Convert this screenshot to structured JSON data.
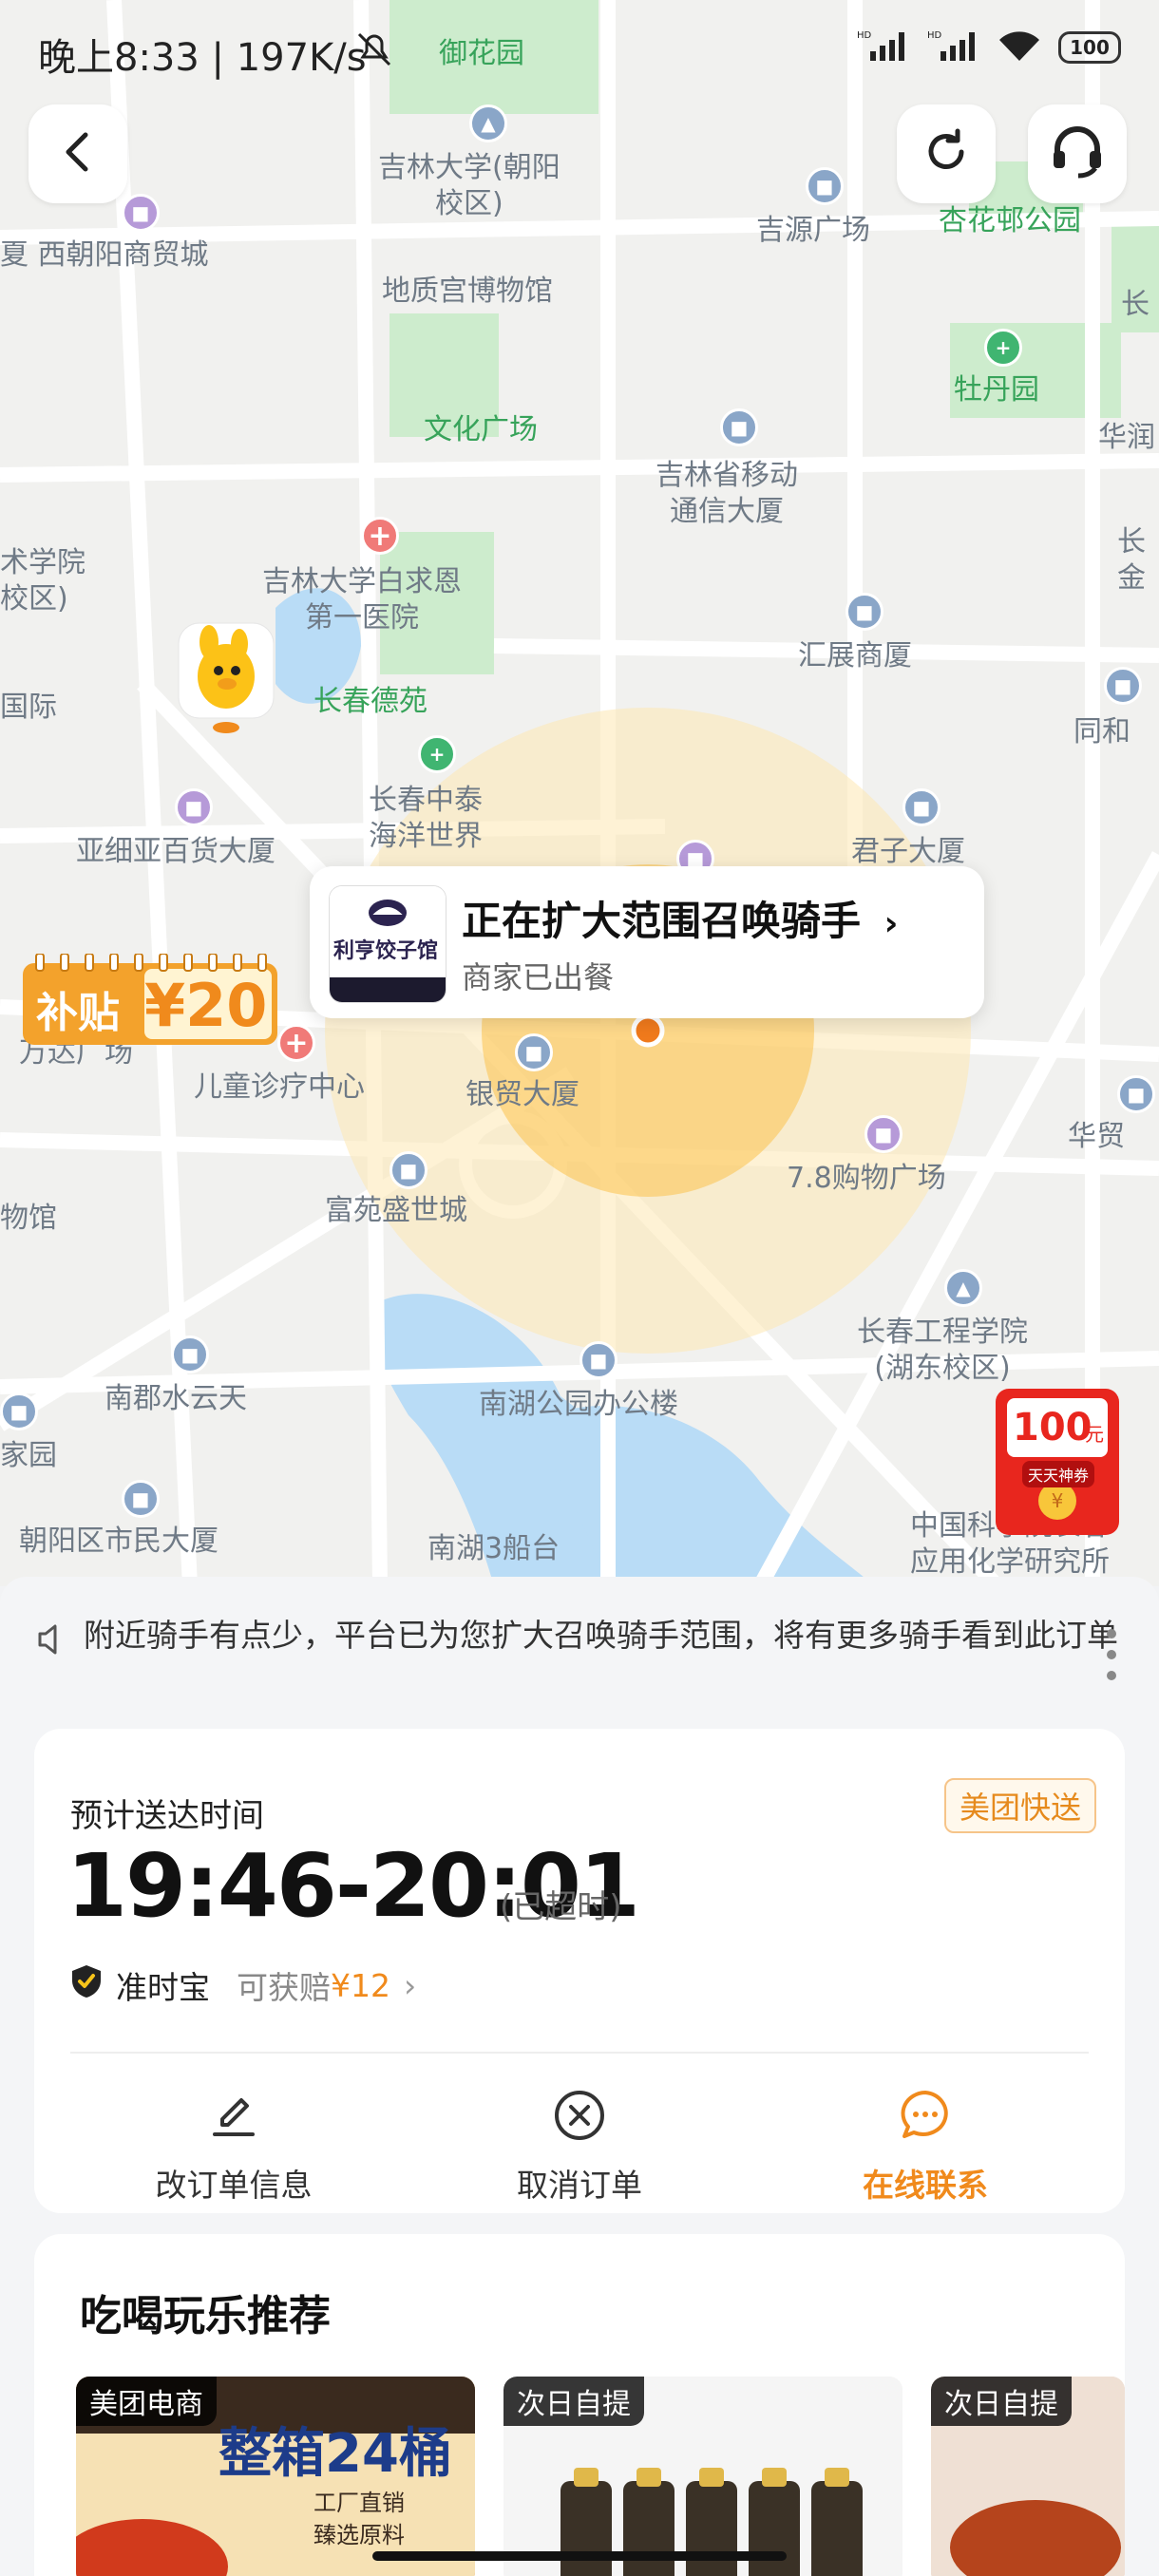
{
  "status_bar": {
    "time": "晚上8:33 | 197K/s",
    "battery": "100"
  },
  "map": {
    "labels": [
      {
        "text": "御花园",
        "color": "green"
      },
      {
        "text": "吉林大学(朝阳\n校区)",
        "color": "gray"
      },
      {
        "text": "吉源广场",
        "color": "gray"
      },
      {
        "text": "杏花邨公园",
        "color": "green"
      },
      {
        "text": "夏 西朝阳商贸城",
        "color": "gray"
      },
      {
        "text": "地质宫博物馆",
        "color": "gray"
      },
      {
        "text": "牡丹园",
        "color": "green"
      },
      {
        "text": "长",
        "color": "gray"
      },
      {
        "text": "华润",
        "color": "gray"
      },
      {
        "text": "文化广场",
        "color": "green"
      },
      {
        "text": "吉林省移动\n通信大厦",
        "color": "gray"
      },
      {
        "text": "术学院\n校区)",
        "color": "gray"
      },
      {
        "text": "吉林大学白求恩\n第一医院",
        "color": "gray"
      },
      {
        "text": "长\n金",
        "color": "gray"
      },
      {
        "text": "汇展商厦",
        "color": "gray"
      },
      {
        "text": "国际",
        "color": "gray"
      },
      {
        "text": "长春德苑",
        "color": "green"
      },
      {
        "text": "同和",
        "color": "gray"
      },
      {
        "text": "长春中泰\n海洋世界",
        "color": "gray"
      },
      {
        "text": "亚细亚百货大厦",
        "color": "gray"
      },
      {
        "text": "君子大厦",
        "color": "gray"
      },
      {
        "text": "万达广场",
        "color": "gray"
      },
      {
        "text": "儿童诊疗中心",
        "color": "gray"
      },
      {
        "text": "银贸大厦",
        "color": "gray"
      },
      {
        "text": "华贸",
        "color": "gray"
      },
      {
        "text": "7.8购物广场",
        "color": "gray"
      },
      {
        "text": "物馆",
        "color": "gray"
      },
      {
        "text": "富苑盛世城",
        "color": "gray"
      },
      {
        "text": "长春工程学院\n(湖东校区)",
        "color": "gray"
      },
      {
        "text": "南郡水云天",
        "color": "gray"
      },
      {
        "text": "南湖公园办公楼",
        "color": "gray"
      },
      {
        "text": "家园",
        "color": "gray"
      },
      {
        "text": "朝阳区市民大厦",
        "color": "gray"
      },
      {
        "text": "南湖3船台",
        "color": "gray"
      },
      {
        "text": "中国科学院长春\n应用化学研究所",
        "color": "gray"
      }
    ],
    "rider_card": {
      "shop_name": "利亨饺子馆",
      "title": "正在扩大范围召唤骑手",
      "subtitle": "商家已出餐"
    },
    "subsidy": {
      "label": "补贴",
      "amount": "¥20"
    },
    "red_packet": {
      "amount": "100",
      "unit": "元",
      "caption": "天天神券"
    }
  },
  "notice": {
    "text": "附近骑手有点少，平台已为您扩大召唤骑手范围，将有更多骑手看到此订单"
  },
  "order": {
    "eta_label": "预计送达时间",
    "delivery_tag": "美团快送",
    "eta_time": "19:46-20:01",
    "overtime": "(已超时)",
    "guarantee_name": "准时宝",
    "guarantee_prefix": "可获赔",
    "guarantee_amount": "¥12",
    "actions": [
      {
        "label": "改订单信息",
        "icon": "edit-icon"
      },
      {
        "label": "取消订单",
        "icon": "cancel-circle-icon"
      },
      {
        "label": "在线联系",
        "icon": "chat-icon"
      }
    ]
  },
  "recommend": {
    "title": "吃喝玩乐推荐",
    "items": [
      {
        "tag": "美团电商",
        "headline": "整箱24桶",
        "sub": "工厂直销\n臻选原料"
      },
      {
        "tag": "次日自提"
      },
      {
        "tag": "次日自提"
      }
    ]
  },
  "colors": {
    "accent_orange": "#f08a1c",
    "map_bg": "#f1f1ef",
    "park_green": "#cdeccd",
    "water_blue": "#b9dcf6"
  }
}
